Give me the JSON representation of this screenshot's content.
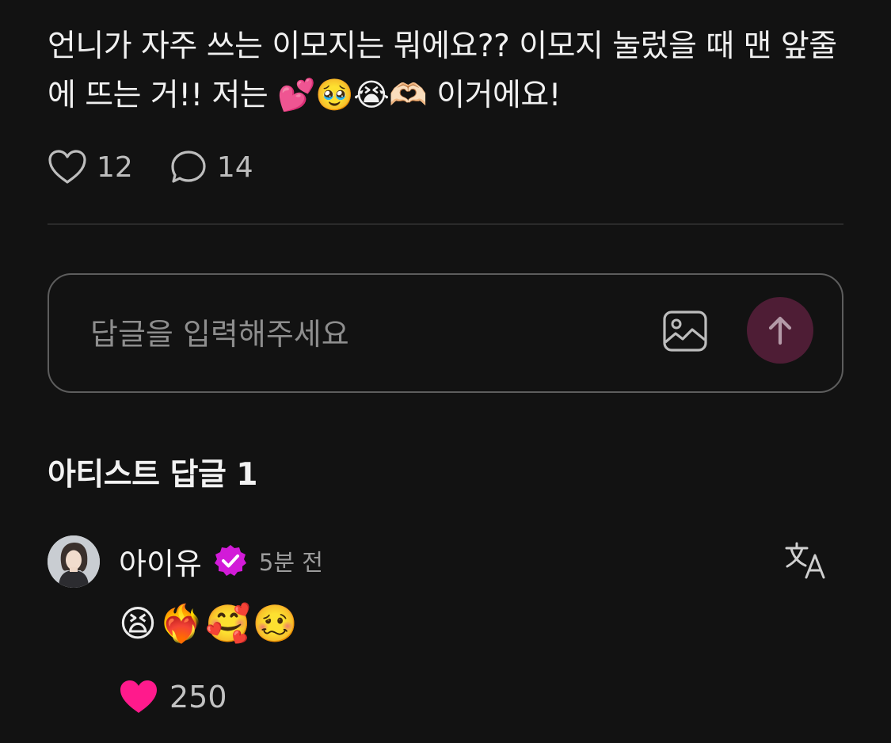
{
  "post": {
    "text": "언니가 자주 쓰는 이모지는 뭐에요?? 이모지 눌렀을 때 맨 앞줄에 뜨는 거!! 저는 💕🥹😭🫶🏻 이거에요!",
    "like_count": "12",
    "comment_count": "14"
  },
  "reply": {
    "placeholder": "답글을 입력해주세요"
  },
  "artist_replies": {
    "title": "아티스트 답글 1",
    "items": [
      {
        "author": "아이유",
        "time": "5분 전",
        "content": "😫❤️‍🔥🥰🥴",
        "like_count": "250"
      }
    ]
  },
  "icons": {
    "post_like": "heart-outline-icon",
    "post_comment": "comment-bubble-icon",
    "attach": "image-icon",
    "send": "arrow-up-icon",
    "verified": "verified-badge-icon",
    "translate": "translate-icon",
    "reply_like": "heart-filled-icon"
  },
  "colors": {
    "background": "#121212",
    "send_button": "#4e1d35",
    "verified_badge": "#d21bd8",
    "liked_heart": "#ff1a8c"
  }
}
